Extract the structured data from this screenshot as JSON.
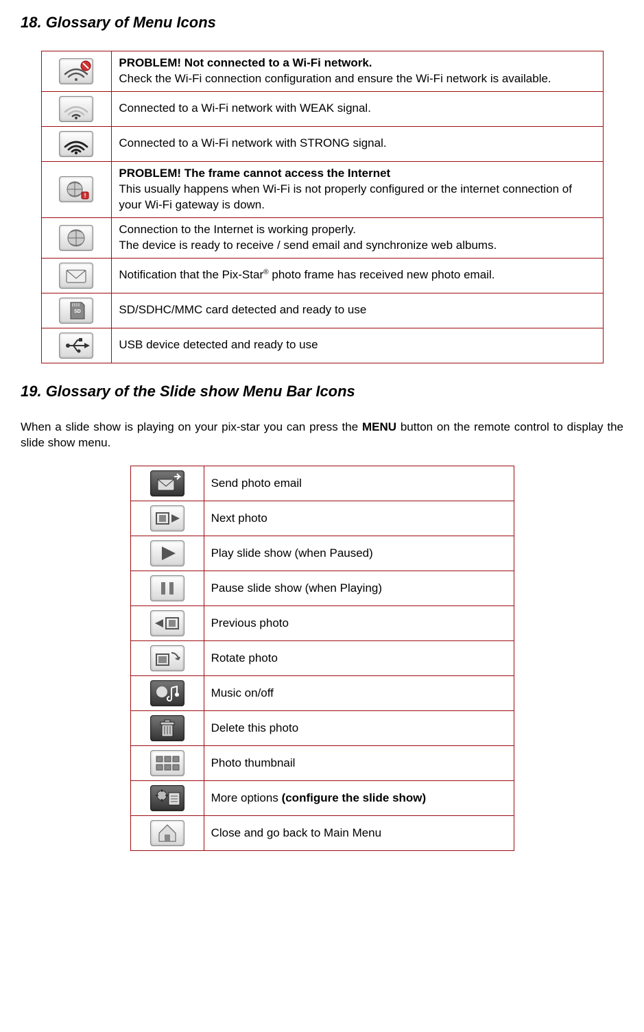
{
  "section18": {
    "heading": "18. Glossary of Menu Icons",
    "rows": [
      {
        "icon": "wifi-problem-icon",
        "bold": "PROBLEM! Not connected to a Wi-Fi network.",
        "text": "Check the Wi-Fi connection configuration and ensure the Wi-Fi network is available.",
        "justify": true
      },
      {
        "icon": "wifi-weak-icon",
        "text": "Connected to a Wi-Fi network with WEAK signal."
      },
      {
        "icon": "wifi-strong-icon",
        "text": "Connected to a Wi-Fi network with STRONG signal."
      },
      {
        "icon": "internet-problem-icon",
        "bold": "PROBLEM! The frame cannot access the Internet",
        "text": "This usually happens when Wi-Fi is not properly configured or the internet connection of your Wi-Fi gateway is down."
      },
      {
        "icon": "internet-ok-icon",
        "text_a": "Connection to the Internet is working properly.",
        "text_b": "The device is ready to receive / send email and synchronize web albums."
      },
      {
        "icon": "email-notification-icon",
        "text_pre": "Notification that the Pix-Star",
        "sup": "®",
        "text_post": " photo frame has received new photo email.",
        "justify": true
      },
      {
        "icon": "sd-card-icon",
        "text": "SD/SDHC/MMC card detected and ready to use"
      },
      {
        "icon": "usb-icon",
        "text": "USB device detected and ready to use"
      }
    ]
  },
  "section19": {
    "heading": "19. Glossary of the Slide show Menu Bar Icons",
    "intro_a": "When a slide show is playing on your pix-star you can press the ",
    "intro_bold": "MENU",
    "intro_b": " button on the remote control to display the slide show menu.",
    "rows": [
      {
        "icon": "send-photo-email-icon",
        "text": "Send photo email"
      },
      {
        "icon": "next-photo-icon",
        "text": "Next photo"
      },
      {
        "icon": "play-icon",
        "text": "Play slide show (when Paused)"
      },
      {
        "icon": "pause-icon",
        "text": "Pause slide show (when Playing)"
      },
      {
        "icon": "previous-photo-icon",
        "text": "Previous photo"
      },
      {
        "icon": "rotate-photo-icon",
        "text": "Rotate photo"
      },
      {
        "icon": "music-toggle-icon",
        "text": "Music on/off"
      },
      {
        "icon": "delete-photo-icon",
        "text": "Delete this photo"
      },
      {
        "icon": "thumbnail-icon",
        "text": "Photo thumbnail"
      },
      {
        "icon": "more-options-icon",
        "text_a": "More options ",
        "bold_b": "(configure the slide show)"
      },
      {
        "icon": "home-icon",
        "text": "Close and go back to Main Menu"
      }
    ]
  }
}
